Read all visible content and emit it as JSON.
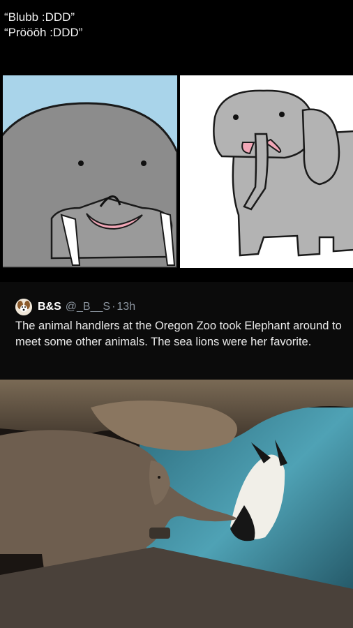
{
  "caption": {
    "line1": "“Blubb :DDD”",
    "line2": "“Prööōh :DDD”"
  },
  "panels": [
    {
      "subject": "walrus-drawing"
    },
    {
      "subject": "elephant-drawing"
    }
  ],
  "tweet": {
    "name": "B&S",
    "handle": "@_B__S",
    "separator": "·",
    "time": "13h",
    "text": "The animal handlers at the Oregon Zoo took Elephant around to meet some other animals. The sea lions were her favorite."
  },
  "photo": {
    "subject": "elephant-and-sea-lion-photo"
  },
  "colors": {
    "background": "#000000",
    "walrus_sky": "#a9d4ea",
    "walrus_body": "#8c8c8c",
    "elephant_body": "#b3b3b3",
    "tongue": "#f2a7b7",
    "handle": "#8b949e"
  }
}
